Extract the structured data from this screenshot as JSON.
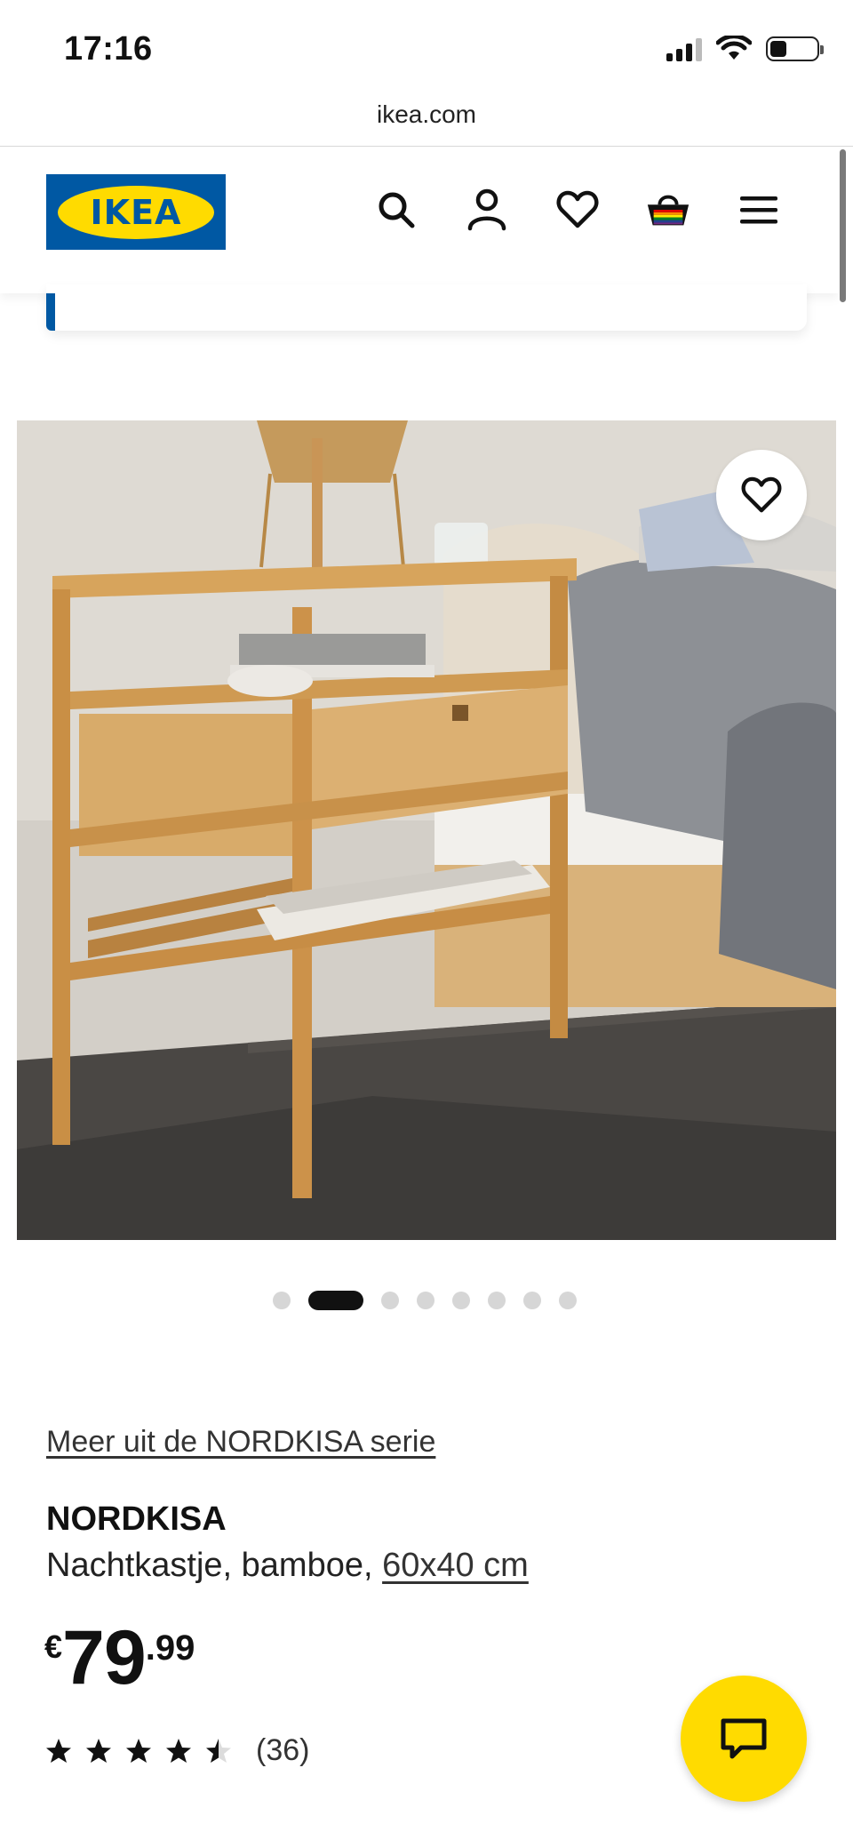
{
  "status_bar": {
    "time": "17:16"
  },
  "browser": {
    "url": "ikea.com"
  },
  "header": {
    "logo_text": "IKEA",
    "icons": [
      "search-icon",
      "profile-icon",
      "heart-icon",
      "basket-icon",
      "menu-icon"
    ]
  },
  "gallery": {
    "image_alt": "Nachtkastje, bamboe",
    "dot_count": 8,
    "active_index": 1
  },
  "product": {
    "series_link": "Meer uit de NORDKISA serie",
    "name": "NORDKISA",
    "description": "Nachtkastje, bamboe, ",
    "size_link": "60x40 cm",
    "price_currency": "€",
    "price_integer": "79",
    "price_decimal": ".99",
    "rating": 4.5,
    "review_count": "(36)"
  },
  "colors": {
    "ikea_blue": "#0058a3",
    "ikea_yellow": "#ffdb00"
  }
}
